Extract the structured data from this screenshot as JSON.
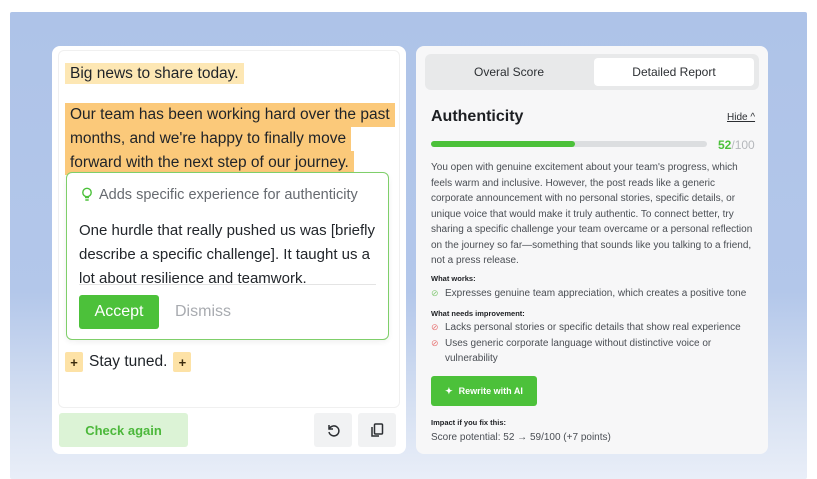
{
  "editor": {
    "paragraph1": "Big news to share today.",
    "paragraph2_lines": [
      "Our team has been working hard over the past",
      "months, and we're happy to finally move",
      "forward with the next step of our journey."
    ],
    "suggestion": {
      "title": "Adds specific experience for authenticity",
      "body": "One hurdle that really pushed us was [briefly describe a specific challenge]. It taught us a lot about resilience and teamwork.",
      "accept_label": "Accept",
      "dismiss_label": "Dismiss"
    },
    "plus_symbol": "+",
    "closing_line": "Stay tuned.",
    "check_again_label": "Check again",
    "icons": [
      "undo-icon",
      "copy-icon",
      "lightbulb-icon"
    ]
  },
  "report": {
    "tabs": [
      {
        "label": "Overal Score",
        "active": false
      },
      {
        "label": "Detailed Report",
        "active": true
      }
    ],
    "section_title": "Authenticity",
    "hide_label": "Hide ^",
    "score": 52,
    "score_max": "/100",
    "score_fraction": 0.52,
    "description": "You open with genuine excitement about your team's progress, which feels warm and inclusive. However, the post reads like a generic corporate announcement with no personal stories, specific details, or unique voice that would make it truly authentic. To connect better, try sharing a specific challenge your team overcame or a personal reflection on the journey so far—something that sounds like you talking to a friend, not a press release.",
    "what_works_label": "What works:",
    "what_works": [
      "Expresses genuine team appreciation, which creates a positive tone"
    ],
    "needs_improvement_label": "What needs improvement:",
    "needs_improvement": [
      "Lacks personal stories or specific details that show real experience",
      "Uses generic corporate language without distinctive voice or vulnerability"
    ],
    "rewrite_label": "Rewrite with AI",
    "impact_label": "Impact if you fix this:",
    "impact_text": "Score potential: 52 → 59/100 (+7 points)"
  },
  "colors": {
    "accent_green": "#4cc13a",
    "highlight_light": "#fde7b4",
    "highlight_strong": "#fbc97a",
    "background_blue": "#aec3e8"
  }
}
